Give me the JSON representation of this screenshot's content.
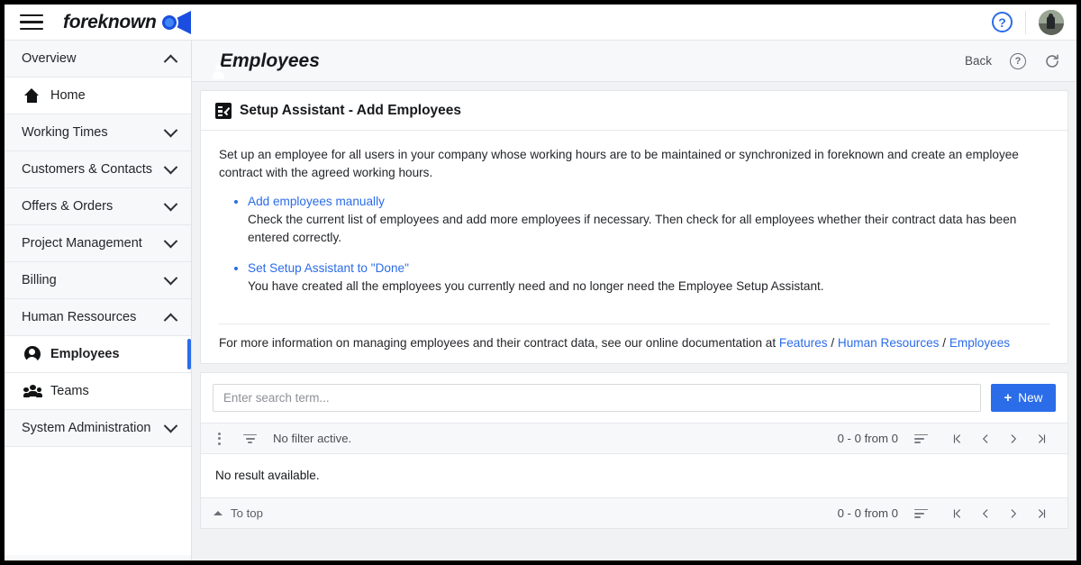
{
  "appbar": {
    "menu_icon": "hamburger-icon",
    "brand_text": "foreknown",
    "help_icon": "?",
    "avatar": "user-avatar"
  },
  "sidebar": {
    "items": [
      {
        "label": "Overview",
        "type": "group",
        "expanded": true,
        "icon": "chevron-up-icon"
      },
      {
        "label": "Home",
        "type": "item",
        "icon": "home-icon",
        "active": false
      },
      {
        "label": "Working Times",
        "type": "group",
        "expanded": false,
        "icon": "chevron-down-icon"
      },
      {
        "label": "Customers & Contacts",
        "type": "group",
        "expanded": false,
        "icon": "chevron-down-icon"
      },
      {
        "label": "Offers & Orders",
        "type": "group",
        "expanded": false,
        "icon": "chevron-down-icon"
      },
      {
        "label": "Project Management",
        "type": "group",
        "expanded": false,
        "icon": "chevron-down-icon"
      },
      {
        "label": "Billing",
        "type": "group",
        "expanded": false,
        "icon": "chevron-down-icon"
      },
      {
        "label": "Human Ressources",
        "type": "group",
        "expanded": true,
        "icon": "chevron-up-icon"
      },
      {
        "label": "Employees",
        "type": "item",
        "icon": "person-icon",
        "active": true
      },
      {
        "label": "Teams",
        "type": "item",
        "icon": "teams-icon",
        "active": false
      },
      {
        "label": "System Administration",
        "type": "group",
        "expanded": false,
        "icon": "chevron-down-icon"
      }
    ]
  },
  "page": {
    "title": "Employees",
    "title_icon": "person-icon",
    "back_label": "Back",
    "help_icon": "?",
    "refresh_icon": "refresh-icon"
  },
  "setup_card": {
    "icon": "fact-check-icon",
    "title": "Setup Assistant - Add Employees",
    "intro": "Set up an employee for all users in your company whose working hours are to be maintained or synchronized in foreknown and create an employee contract with the agreed working hours.",
    "tasks": [
      {
        "link": "Add employees manually",
        "description": "Check the current list of employees and add more employees if necessary. Then check for all employees whether their contract data has been entered correctly."
      },
      {
        "link": "Set Setup Assistant to \"Done\"",
        "description": "You have created all the employees you currently need and no longer need the Employee Setup Assistant."
      }
    ],
    "footer_text": "For more information on managing employees and their contract data, see our online documentation at ",
    "footer_links": [
      "Features",
      "Human Resources",
      "Employees"
    ],
    "footer_separator": " / "
  },
  "list": {
    "search_placeholder": "Enter search term...",
    "search_value": "",
    "new_button": "New",
    "new_button_icon": "plus-icon",
    "menu_icon": "kebab-menu-icon",
    "filter_icon": "filter-icon",
    "filter_text": "No filter active.",
    "sort_icon": "sort-icon",
    "pagination_count": "0 - 0 from 0",
    "nav": {
      "first": "first-page-icon",
      "prev": "previous-page-icon",
      "next": "next-page-icon",
      "last": "last-page-icon"
    },
    "empty_text": "No result available.",
    "to_top_label": "To top",
    "to_top_icon": "caret-up-icon",
    "bottom_pagination_count": "0 - 0 from 0"
  },
  "colors": {
    "accent": "#2b6ce8",
    "link": "#2b6ce8",
    "sidebar_bg": "#f7f8fa",
    "main_bg": "#f1f2f4"
  }
}
